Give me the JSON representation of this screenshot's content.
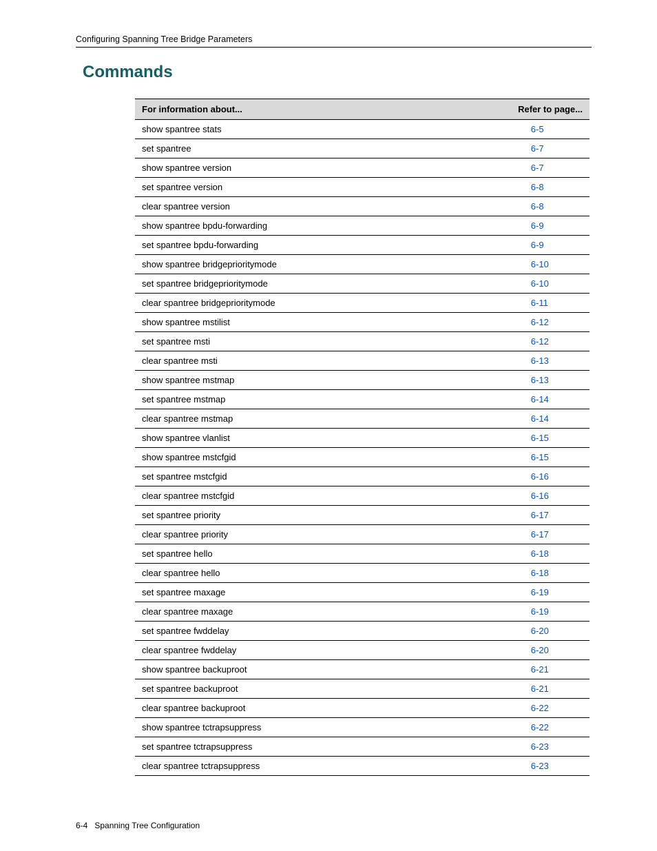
{
  "header": {
    "breadcrumb": "Configuring Spanning Tree Bridge Parameters"
  },
  "section": {
    "title": "Commands"
  },
  "table": {
    "header_info": "For information about...",
    "header_page": "Refer to page...",
    "rows": [
      {
        "cmd": "show spantree stats",
        "page": "6-5"
      },
      {
        "cmd": "set spantree",
        "page": "6-7"
      },
      {
        "cmd": "show spantree version",
        "page": "6-7"
      },
      {
        "cmd": "set spantree version",
        "page": "6-8"
      },
      {
        "cmd": "clear spantree version",
        "page": "6-8"
      },
      {
        "cmd": "show spantree bpdu-forwarding",
        "page": "6-9"
      },
      {
        "cmd": "set spantree bpdu-forwarding",
        "page": "6-9"
      },
      {
        "cmd": "show spantree bridgeprioritymode",
        "page": "6-10"
      },
      {
        "cmd": "set spantree bridgeprioritymode",
        "page": "6-10"
      },
      {
        "cmd": "clear spantree bridgeprioritymode",
        "page": "6-11"
      },
      {
        "cmd": "show spantree mstilist",
        "page": "6-12"
      },
      {
        "cmd": "set spantree msti",
        "page": "6-12"
      },
      {
        "cmd": "clear spantree msti",
        "page": "6-13"
      },
      {
        "cmd": "show spantree mstmap",
        "page": "6-13"
      },
      {
        "cmd": "set spantree mstmap",
        "page": "6-14"
      },
      {
        "cmd": "clear spantree mstmap",
        "page": "6-14"
      },
      {
        "cmd": "show spantree vlanlist",
        "page": "6-15"
      },
      {
        "cmd": "show spantree mstcfgid",
        "page": "6-15"
      },
      {
        "cmd": "set spantree mstcfgid",
        "page": "6-16"
      },
      {
        "cmd": "clear spantree mstcfgid",
        "page": "6-16"
      },
      {
        "cmd": "set spantree priority",
        "page": "6-17"
      },
      {
        "cmd": "clear spantree priority",
        "page": "6-17"
      },
      {
        "cmd": "set spantree hello",
        "page": "6-18"
      },
      {
        "cmd": "clear spantree hello",
        "page": "6-18"
      },
      {
        "cmd": "set spantree maxage",
        "page": "6-19"
      },
      {
        "cmd": "clear spantree maxage",
        "page": "6-19"
      },
      {
        "cmd": "set spantree fwddelay",
        "page": "6-20"
      },
      {
        "cmd": "clear spantree fwddelay",
        "page": "6-20"
      },
      {
        "cmd": "show spantree backuproot",
        "page": "6-21"
      },
      {
        "cmd": "set spantree backuproot",
        "page": "6-21"
      },
      {
        "cmd": "clear spantree backuproot",
        "page": "6-22"
      },
      {
        "cmd": "show spantree tctrapsuppress",
        "page": "6-22"
      },
      {
        "cmd": "set spantree tctrapsuppress",
        "page": "6-23"
      },
      {
        "cmd": "clear spantree tctrapsuppress",
        "page": "6-23"
      }
    ]
  },
  "footer": {
    "page_no": "6-4",
    "chapter": "Spanning Tree Configuration"
  }
}
